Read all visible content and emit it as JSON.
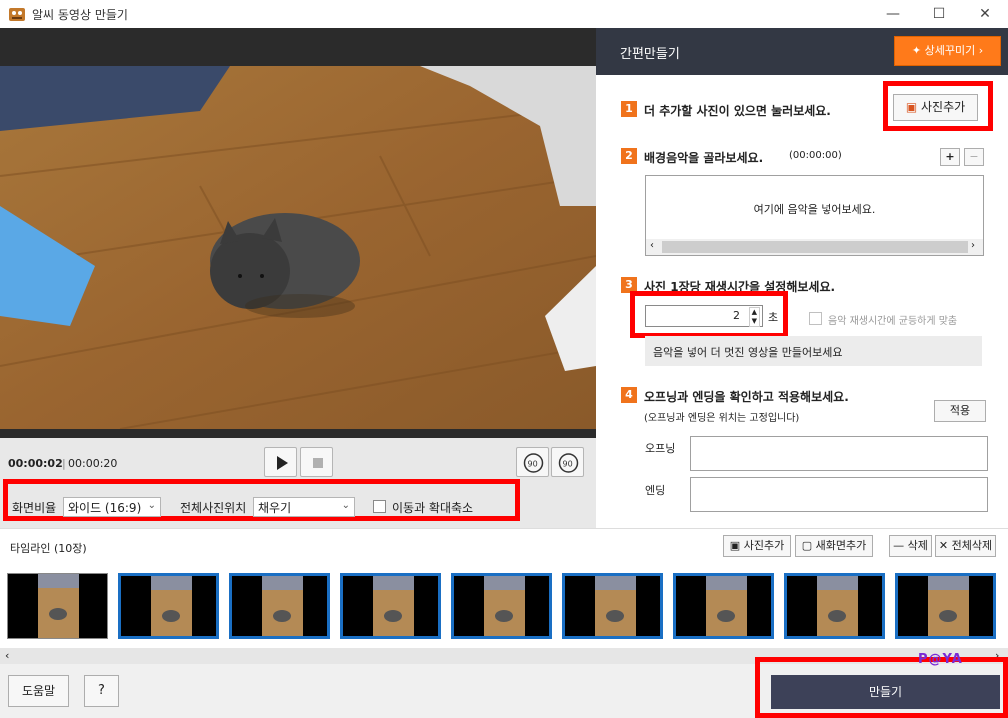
{
  "window": {
    "title": "알씨 동영상 만들기",
    "controls": {
      "minimize": "—",
      "maximize": "☐",
      "close": "✕"
    }
  },
  "player": {
    "time_current": "00:00:02",
    "time_separator": "|",
    "time_total": "00:00:20",
    "rotate_left_label": "90",
    "rotate_right_label": "90"
  },
  "options": {
    "aspect_label": "화면비율",
    "aspect_value": "와이드 (16:9)",
    "position_label": "전체사진위치",
    "position_value": "채우기",
    "motion_label": "이동과 확대축소"
  },
  "panel": {
    "title": "간편만들기",
    "detail_button": "상세꾸미기",
    "step1": {
      "num": "1",
      "text": "더 추가할 사진이 있으면 눌러보세요.",
      "button": "사진추가"
    },
    "step2": {
      "num": "2",
      "text": "배경음악을 골라보세요.",
      "duration": "(00:00:00)",
      "placeholder": "여기에 음악을 넣어보세요.",
      "add": "+",
      "remove": "−"
    },
    "step3": {
      "num": "3",
      "text": "사진 1장당 재생시간을 설정해보세요.",
      "seconds_value": "2",
      "seconds_unit": "초",
      "fit_music_label": "음악 재생시간에 균등하게 맞춤",
      "hint": "음악을 넣어 더 멋진 영상을 만들어보세요"
    },
    "step4": {
      "num": "4",
      "text": "오프닝과 엔딩을 확인하고 적용해보세요.",
      "subtext": "(오프닝과 엔딩은 위치는 고정입니다)",
      "apply": "적용",
      "opening_label": "오프닝",
      "ending_label": "엔딩"
    }
  },
  "timeline": {
    "title": "타임라인 (10장)",
    "add_photo": "사진추가",
    "new_screen": "새화면추가",
    "delete": "삭제",
    "delete_all": "전체삭제",
    "thumb_count": 9
  },
  "bottom": {
    "help": "도움말",
    "question": "?",
    "make": "만들기",
    "watermark": "P@YA"
  },
  "colors": {
    "accent_orange": "#f0731c",
    "panel_header": "#333844",
    "make_button": "#3d4158",
    "highlight_red": "#ff0000",
    "thumb_border": "#1a6fc4"
  }
}
